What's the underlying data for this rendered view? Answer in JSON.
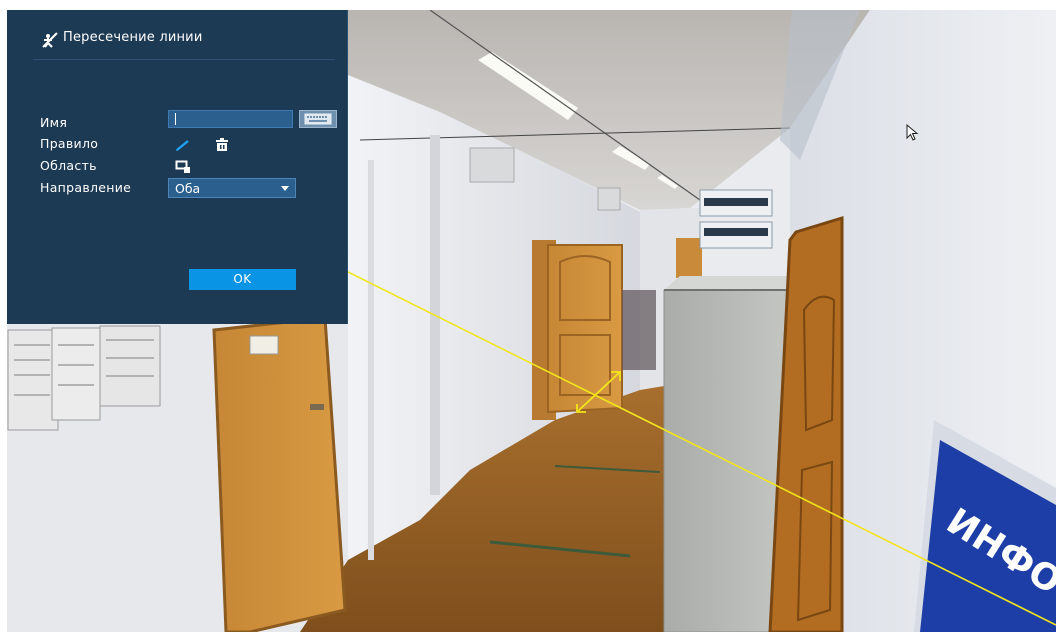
{
  "dialog": {
    "title": "Пересечение линии",
    "fields": {
      "name_label": "Имя",
      "name_value": "",
      "rule_label": "Правило",
      "area_label": "Область",
      "direction_label": "Направление",
      "direction_value": "Оба"
    },
    "ok_label": "OK"
  },
  "scene": {
    "sign_text": "ИНФО"
  },
  "colors": {
    "panel_bg": "#1d3a55",
    "input_bg": "#2a5f8e",
    "accent": "#0a94e6",
    "tripwire": "#f2e51a"
  }
}
